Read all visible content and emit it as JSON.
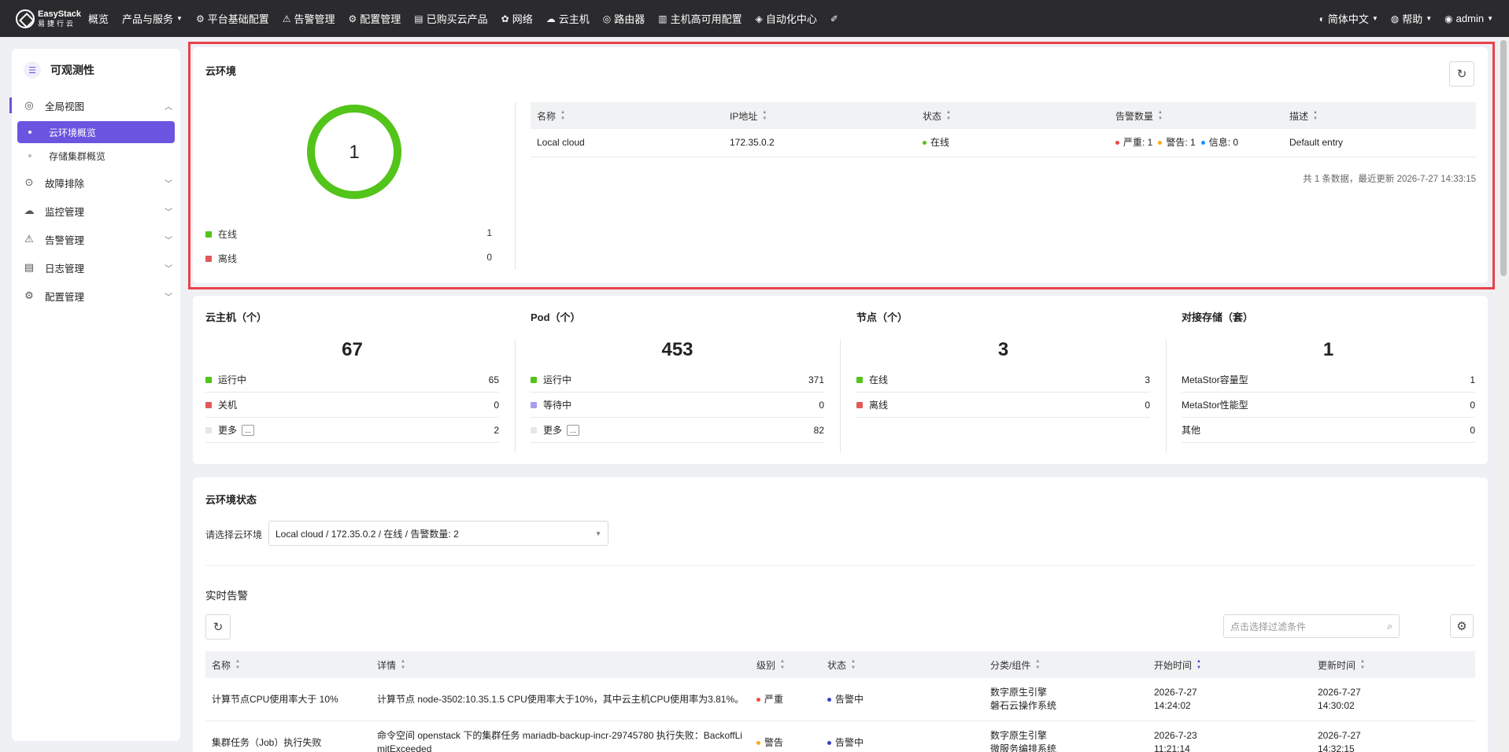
{
  "nav": {
    "logo_line1": "EasyStack",
    "logo_line2": "易捷行云",
    "items": [
      {
        "label": "概览",
        "icon": "",
        "caret": false
      },
      {
        "label": "产品与服务",
        "icon": "",
        "caret": true
      },
      {
        "label": "平台基础配置",
        "icon": "⚙",
        "caret": false
      },
      {
        "label": "告警管理",
        "icon": "⚠",
        "caret": false
      },
      {
        "label": "配置管理",
        "icon": "⚙",
        "caret": false
      },
      {
        "label": "已购买云产品",
        "icon": "▤",
        "caret": false
      },
      {
        "label": "网络",
        "icon": "✿",
        "caret": false
      },
      {
        "label": "云主机",
        "icon": "☁",
        "caret": false
      },
      {
        "label": "路由器",
        "icon": "◎",
        "caret": false
      },
      {
        "label": "主机高可用配置",
        "icon": "▥",
        "caret": false
      },
      {
        "label": "自动化中心",
        "icon": "◈",
        "caret": false
      },
      {
        "label": "",
        "icon": "✐",
        "caret": false
      }
    ],
    "right": [
      {
        "label": "简体中文",
        "icon": "◐"
      },
      {
        "label": "帮助",
        "icon": "◍"
      },
      {
        "label": "admin",
        "icon": "◉"
      }
    ]
  },
  "sidebar": {
    "title": "可观测性",
    "title_icon": "☰",
    "groups": [
      {
        "label": "全局视图",
        "icon": "◎",
        "expanded": true,
        "subs": [
          {
            "label": "云环境概览",
            "active": true
          },
          {
            "label": "存储集群概览",
            "active": false
          }
        ]
      },
      {
        "label": "故障排除",
        "icon": "⊙",
        "expanded": false,
        "subs": []
      },
      {
        "label": "监控管理",
        "icon": "☁",
        "expanded": false,
        "subs": []
      },
      {
        "label": "告警管理",
        "icon": "⚠",
        "expanded": false,
        "subs": []
      },
      {
        "label": "日志管理",
        "icon": "▤",
        "expanded": false,
        "subs": []
      },
      {
        "label": "配置管理",
        "icon": "⚙",
        "expanded": false,
        "subs": []
      }
    ]
  },
  "cloud_env": {
    "title": "云环境",
    "ring_value": "1",
    "online_fraction": 1.0,
    "legend": [
      {
        "label": "在线",
        "value": "1",
        "color": "#52c41a"
      },
      {
        "label": "离线",
        "value": "0",
        "color": "#e05a5a"
      }
    ],
    "table": {
      "columns": [
        "名称",
        "IP地址",
        "状态",
        "告警数量",
        "描述"
      ],
      "rows": [
        {
          "name": "Local cloud",
          "ip": "172.35.0.2",
          "status": "在线",
          "alerts": [
            {
              "label": "严重: 1",
              "color": "#f5473e"
            },
            {
              "label": "警告: 1",
              "color": "#faad14"
            },
            {
              "label": "信息: 0",
              "color": "#1890ff"
            }
          ],
          "desc": "Default entry"
        }
      ],
      "footer": "共 1 条数据，最近更新  2026-7-27 14:33:15"
    }
  },
  "stats": [
    {
      "title": "云主机（个）",
      "total": "67",
      "rows": [
        {
          "label": "运行中",
          "value": "65",
          "color": "#52c41a",
          "more": false
        },
        {
          "label": "关机",
          "value": "0",
          "color": "#e05a5a",
          "more": false
        },
        {
          "label": "更多",
          "value": "2",
          "color": "#e6e6e6",
          "more": true
        }
      ]
    },
    {
      "title": "Pod（个）",
      "total": "453",
      "rows": [
        {
          "label": "运行中",
          "value": "371",
          "color": "#52c41a",
          "more": false
        },
        {
          "label": "等待中",
          "value": "0",
          "color": "#a59ff0",
          "more": false
        },
        {
          "label": "更多",
          "value": "82",
          "color": "#e6e6e6",
          "more": true
        }
      ]
    },
    {
      "title": "节点（个）",
      "total": "3",
      "rows": [
        {
          "label": "在线",
          "value": "3",
          "color": "#52c41a",
          "more": false
        },
        {
          "label": "离线",
          "value": "0",
          "color": "#e05a5a",
          "more": false
        }
      ]
    },
    {
      "title": "对接存储（套）",
      "total": "1",
      "rows": [
        {
          "label": "MetaStor容量型",
          "value": "1",
          "color": "",
          "more": false
        },
        {
          "label": "MetaStor性能型",
          "value": "0",
          "color": "",
          "more": false
        },
        {
          "label": "其他",
          "value": "0",
          "color": "",
          "more": false
        }
      ]
    }
  ],
  "more_glyph": "...",
  "env_status": {
    "title": "云环境状态",
    "select_label": "请选择云环境",
    "select_value": "Local cloud / 172.35.0.2 / 在线 / 告警数量: 2",
    "alerts_title": "实时告警",
    "search_placeholder": "点击选择过滤条件",
    "columns": [
      "名称",
      "详情",
      "级别",
      "状态",
      "分类/组件",
      "开始时间",
      "更新时间"
    ],
    "rows": [
      {
        "name": "计算节点CPU使用率大于 10%",
        "detail": "计算节点 node-3502:10.35.1.5 CPU使用率大于10%，其中云主机CPU使用率为3.81%。",
        "level": "严重",
        "level_color": "#f5473e",
        "state": "告警中",
        "state_color": "#3a3fc4",
        "cat1": "数字原生引擎",
        "cat2": "磐石云操作系统",
        "start1": "2026-7-27",
        "start2": "14:24:02",
        "upd1": "2026-7-27",
        "upd2": "14:30:02"
      },
      {
        "name": "集群任务（Job）执行失败",
        "detail": "命令空间 openstack 下的集群任务 mariadb-backup-incr-29745780 执行失败：BackoffLimitExceeded",
        "level": "警告",
        "level_color": "#faad14",
        "state": "告警中",
        "state_color": "#3a3fc4",
        "cat1": "数字原生引擎",
        "cat2": "微服务编排系统",
        "start1": "2026-7-23",
        "start2": "11:21:14",
        "upd1": "2026-7-27",
        "upd2": "14:32:15"
      }
    ]
  }
}
